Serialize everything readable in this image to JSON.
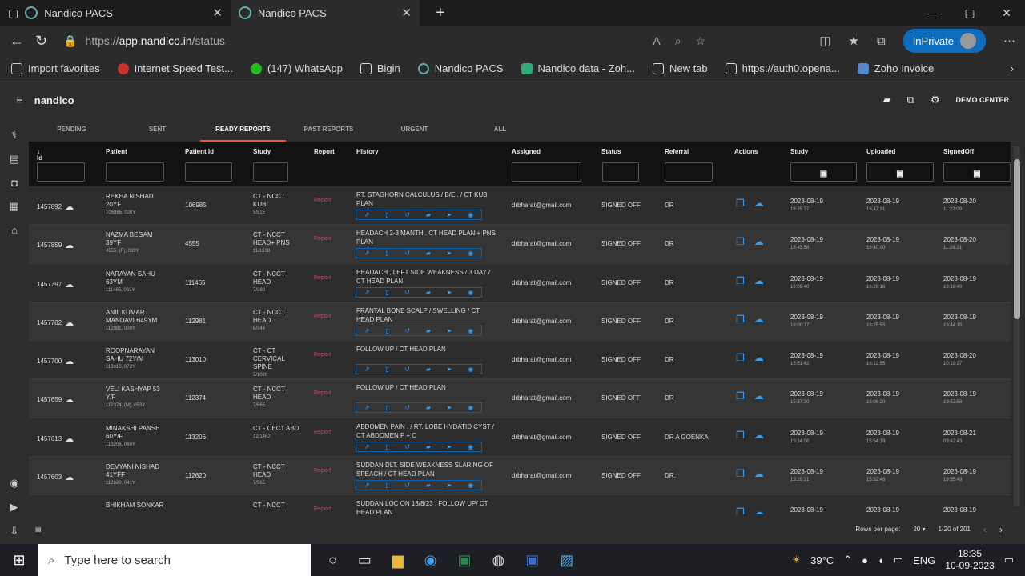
{
  "browser": {
    "tab1": "Nandico PACS",
    "tab2": "Nandico PACS",
    "url_scheme": "https://",
    "url_domain": "app.nandico.in",
    "url_path": "/status",
    "inprivate": "InPrivate"
  },
  "favorites": [
    "Import favorites",
    "Internet Speed Test...",
    "(147) WhatsApp",
    "Bigin",
    "Nandico PACS",
    "Nandico data - Zoh...",
    "New tab",
    "https://auth0.opena...",
    "Zoho Invoice"
  ],
  "app": {
    "logo": "nandico",
    "center": "DEMO CENTER",
    "tabs": [
      "PENDING",
      "SENT",
      "READY REPORTS",
      "PAST REPORTS",
      "URGENT",
      "ALL"
    ],
    "columns": [
      "Id",
      "Patient",
      "Patient Id",
      "Study",
      "Report",
      "History",
      "Assigned",
      "Status",
      "Referral",
      "Actions",
      "Study",
      "Uploaded",
      "SignedOff"
    ],
    "rows": [
      {
        "id": "1457892",
        "name": "REKHA NISHAD 20YF",
        "sub": "106985, 020Y",
        "pid": "106985",
        "study": "CT - NCCT KUB",
        "ss": "5/825",
        "hist": "RT. STAGHORN CALCULUS / B/E . / CT KUB PLAN",
        "asg": "drbharat@gmail.com",
        "status": "SIGNED OFF",
        "ref": "DR",
        "d1": "2023-08-19",
        "t1": "16:25:27",
        "d2": "2023-08-19",
        "t2": "16:47:31",
        "d3": "2023-08-20",
        "t3": "11:22:09"
      },
      {
        "id": "1457859",
        "name": "NAZMA BEGAM 39YF",
        "sub": "4555, (F), 039Y",
        "pid": "4555",
        "study": "CT - NCCT HEAD+ PNS",
        "ss": "11/1338",
        "hist": "HEADACH 2-3 MANTH . CT HEAD PLAN + PNS PLAN",
        "asg": "drbharat@gmail.com",
        "status": "SIGNED OFF",
        "ref": "DR",
        "d1": "2023-08-19",
        "t1": "15:43:58",
        "d2": "2023-08-19",
        "t2": "16:40:00",
        "d3": "2023-08-20",
        "t3": "11:28:21"
      },
      {
        "id": "1457797",
        "name": "NARAYAN SAHU 63YM",
        "sub": "111465, 063Y",
        "pid": "111465",
        "study": "CT - NCCT HEAD",
        "ss": "7/389",
        "hist": "HEADACH , LEFT SIDE WEAKNESS / 3 DAY / CT HEAD PLAN",
        "asg": "drbharat@gmail.com",
        "status": "SIGNED OFF",
        "ref": "DR",
        "d1": "2023-08-19",
        "t1": "16:09:40",
        "d2": "2023-08-19",
        "t2": "16:28:16",
        "d3": "2023-08-19",
        "t3": "19:18:40"
      },
      {
        "id": "1457782",
        "name": "ANIL KUMAR MANDAVI B49YM",
        "sub": "112981, 000Y",
        "pid": "112981",
        "study": "CT - NCCT HEAD",
        "ss": "6/344",
        "hist": "FRANTAL BONE SCALP / SWELLING / CT HEAD PLAN",
        "asg": "drbharat@gmail.com",
        "status": "SIGNED OFF",
        "ref": "DR",
        "d1": "2023-08-19",
        "t1": "16:00:17",
        "d2": "2023-08-19",
        "t2": "16:25:55",
        "d3": "2023-08-19",
        "t3": "19:44:15"
      },
      {
        "id": "1457700",
        "name": "ROOPNARAYAN SAHU 72Y/M",
        "sub": "113010, 072Y",
        "pid": "113010",
        "study": "CT - CT CERVICAL SPINE",
        "ss": "5/1020",
        "hist": "FOLLOW UP / CT HEAD PLAN",
        "asg": "drbharat@gmail.com",
        "status": "SIGNED OFF",
        "ref": "DR",
        "d1": "2023-08-19",
        "t1": "15:51:42",
        "d2": "2023-08-19",
        "t2": "16:12:55",
        "d3": "2023-08-20",
        "t3": "10:19:37"
      },
      {
        "id": "1457659",
        "name": "VELI KASHYAP 53 Y/F",
        "sub": "112374, (M), 053Y",
        "pid": "112374",
        "study": "CT - NCCT HEAD",
        "ss": "7/565",
        "hist": "FOLLOW UP / CT HEAD PLAN",
        "asg": "drbharat@gmail.com",
        "status": "SIGNED OFF",
        "ref": "DR",
        "d1": "2023-08-19",
        "t1": "15:37:30",
        "d2": "2023-08-19",
        "t2": "16:06:20",
        "d3": "2023-08-19",
        "t3": "19:52:58"
      },
      {
        "id": "1457613",
        "name": "MINAKSHI PANSE 60Y/F",
        "sub": "113206, 060Y",
        "pid": "113206",
        "study": "CT - CECT ABD",
        "ss": "12/1462",
        "hist": "ABDOMEN PAIN . / RT. LOBE HYDATID CYST / CT ABDOMEN P + C",
        "asg": "drbharat@gmail.com",
        "status": "SIGNED OFF",
        "ref": "DR A GOENKA",
        "d1": "2023-08-19",
        "t1": "15:14:06",
        "d2": "2023-08-19",
        "t2": "15:54:19",
        "d3": "2023-08-21",
        "t3": "09:42:43"
      },
      {
        "id": "1457603",
        "name": "DEVYANI NISHAD 41YFF",
        "sub": "112620, 041Y",
        "pid": "112620",
        "study": "CT - NCCT HEAD",
        "ss": "7/565",
        "hist": "SUDDAN DLT. SIDE WEAKNESS SLARING OF SPEACH / CT HEAD PLAN",
        "asg": "drbharat@gmail.com",
        "status": "SIGNED OFF",
        "ref": "DR.",
        "d1": "2023-08-19",
        "t1": "15:29:31",
        "d2": "2023-08-19",
        "t2": "15:52:46",
        "d3": "2023-08-19",
        "t3": "19:55:49"
      },
      {
        "id": "",
        "name": "BHIKHAM SONKAR",
        "sub": "",
        "pid": "",
        "study": "CT - NCCT",
        "ss": "",
        "hist": "SUDDAN LOC ON 18/8/23 . FOLLOW UP/ CT HEAD PLAN",
        "asg": "",
        "status": "",
        "ref": "",
        "d1": "2023-08-19",
        "t1": "",
        "d2": "2023-08-19",
        "t2": "",
        "d3": "2023-08-19",
        "t3": ""
      }
    ],
    "report_label": "Report",
    "footer": {
      "rows_label": "Rows per page:",
      "rows_value": "20",
      "range": "1-20 of 201"
    }
  },
  "taskbar": {
    "search": "Type here to search",
    "temp": "39°C",
    "lang": "ENG",
    "time": "18:35",
    "date": "10-09-2023"
  }
}
